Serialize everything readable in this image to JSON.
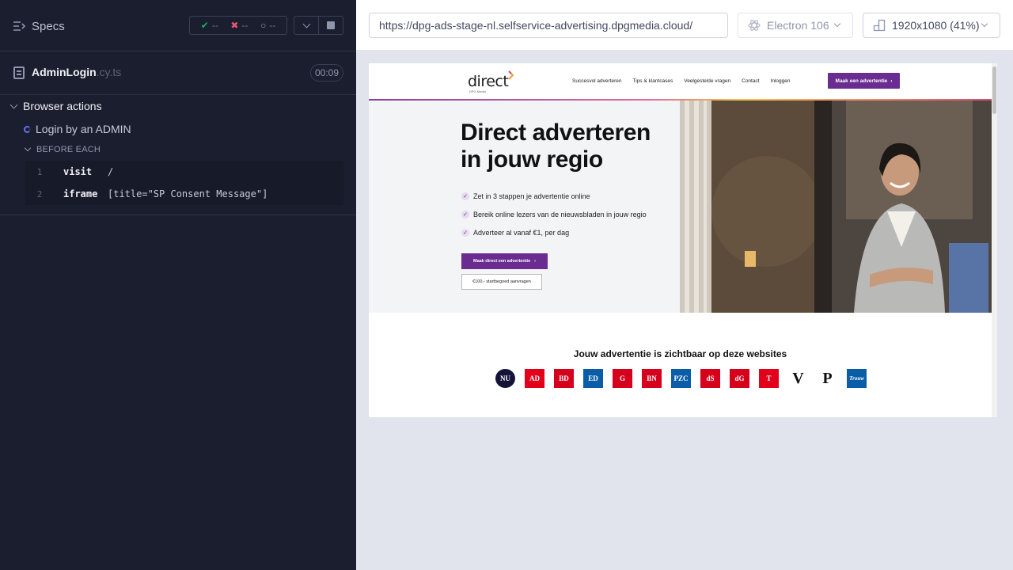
{
  "runner": {
    "specs_label": "Specs",
    "stats": {
      "passed": "--",
      "failed": "--",
      "pending": "--"
    },
    "spec_file": {
      "name": "AdminLogin",
      "ext": ".cy.ts",
      "duration": "00:09"
    },
    "suite": "Browser actions",
    "test": "Login by an ADMIN",
    "hook": "BEFORE EACH",
    "commands": [
      {
        "num": "1",
        "name": "visit",
        "message": "/"
      },
      {
        "num": "2",
        "name": "iframe",
        "message": "[title=\"SP Consent Message\"]"
      }
    ]
  },
  "aut_bar": {
    "url": "https://dpg-ads-stage-nl.selfservice-advertising.dpgmedia.cloud/",
    "browser": "Electron 106",
    "viewport": "1920x1080  (41%)"
  },
  "site": {
    "logo": "direct",
    "logo_sub": "DPG Media",
    "nav": [
      "Succesvol adverteren",
      "Tips & klantcases",
      "Veelgestelde vragen",
      "Contact",
      "Inloggen"
    ],
    "nav_cta": "Maak een advertentie",
    "hero_title_1": "Direct adverteren",
    "hero_title_2": "in jouw regio",
    "checks": [
      "Zet in 3 stappen je advertentie online",
      "Bereik online lezers van de nieuwsbladen in jouw regio",
      "Adverteer al vanaf €1, per dag"
    ],
    "cta_primary": "Maak direct een advertentie",
    "cta_secondary": "€100,- startbegoed aanvragen",
    "visible_title": "Jouw advertentie is zichtbaar op deze websites",
    "brands": [
      {
        "label": "NU",
        "bg": "#14143a"
      },
      {
        "label": "AD",
        "bg": "#e3001b"
      },
      {
        "label": "BD",
        "bg": "#d5001c"
      },
      {
        "label": "ED",
        "bg": "#0a5da6"
      },
      {
        "label": "G",
        "bg": "#d5001c"
      },
      {
        "label": "BN",
        "bg": "#d5001c"
      },
      {
        "label": "PZC",
        "bg": "#0a5da6"
      },
      {
        "label": "dS",
        "bg": "#d5001c"
      },
      {
        "label": "dG",
        "bg": "#d5001c"
      },
      {
        "label": "T",
        "bg": "#e3001b"
      },
      {
        "label": "V",
        "bg": "#ffffff"
      },
      {
        "label": "P",
        "bg": "#ffffff"
      },
      {
        "label": "Trouw",
        "bg": "#0a5da6"
      }
    ]
  },
  "colors": {
    "runner_bg": "#1b1e2e",
    "accent_purple": "#6b2c91",
    "pass": "#1fa971",
    "fail": "#e45770"
  }
}
